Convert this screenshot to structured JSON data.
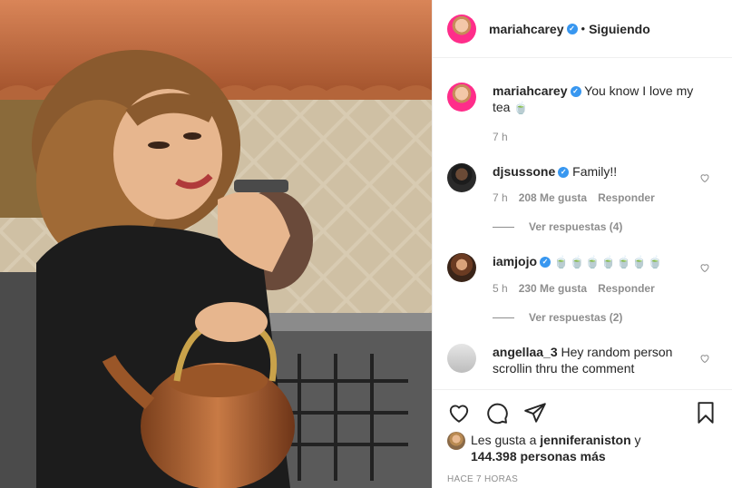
{
  "post": {
    "username": "mariahcarey",
    "follow_label": "Siguiendo",
    "separator": "•"
  },
  "caption": {
    "username": "mariahcarey",
    "text": "You know I love my tea",
    "emoji": "🍵",
    "time": "7 h"
  },
  "comments": [
    {
      "username": "djsussone",
      "verified": true,
      "text": "Family!!",
      "time": "7 h",
      "likes": "208 Me gusta",
      "reply_label": "Responder",
      "view_replies": "Ver respuestas (4)"
    },
    {
      "username": "iamjojo",
      "verified": true,
      "text": "🍵🍵🍵🍵🍵🍵🍵",
      "time": "5 h",
      "likes": "230 Me gusta",
      "reply_label": "Responder",
      "view_replies": "Ver respuestas (2)"
    },
    {
      "username": "angellaa_3",
      "verified": false,
      "text": "Hey random person scrollin thru the comment"
    }
  ],
  "likes": {
    "prefix": "Les gusta a",
    "user": "jenniferaniston",
    "connector": "y",
    "others": "144.398 personas más"
  },
  "timestamp": "HACE 7 HORAS",
  "icons": [
    "heart-icon",
    "comment-icon",
    "share-icon",
    "bookmark-icon",
    "verified-badge-icon"
  ],
  "colors": {
    "verified": "#3897f0",
    "text": "#262626",
    "muted": "#8e8e8e",
    "border": "#efefef"
  }
}
